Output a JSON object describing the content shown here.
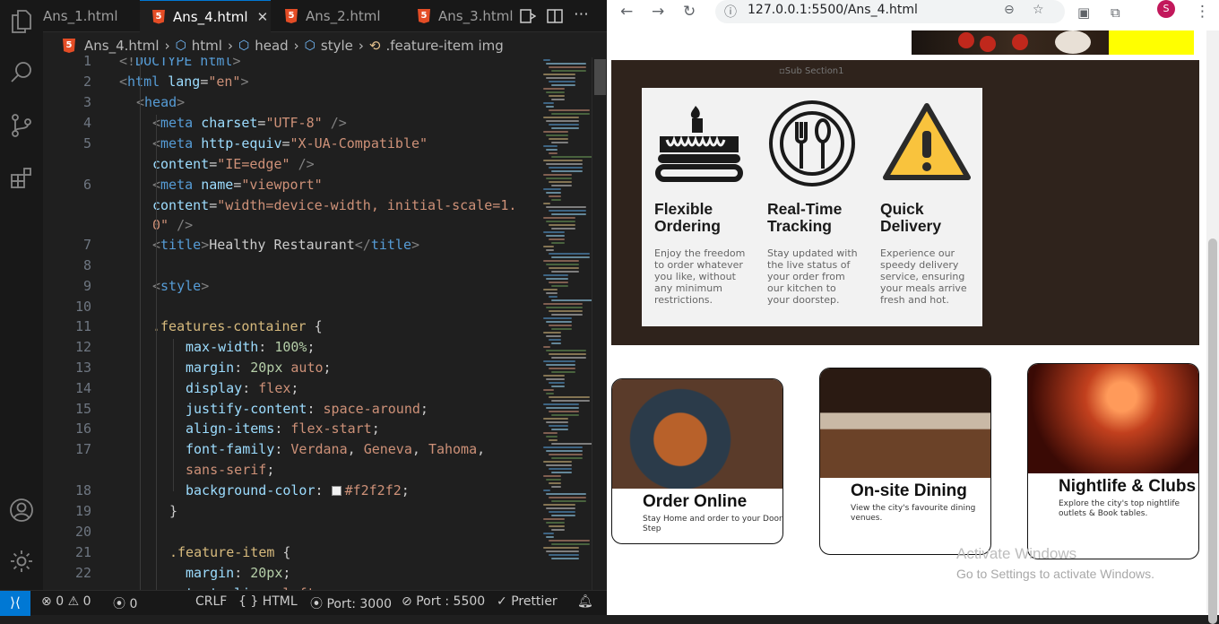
{
  "editor": {
    "tabs": [
      {
        "label": "Ans_1.html",
        "active": false
      },
      {
        "label": "Ans_4.html",
        "active": true
      },
      {
        "label": "Ans_2.html",
        "active": false
      },
      {
        "label": "Ans_3.html",
        "active": false
      }
    ],
    "breadcrumb": [
      "Ans_4.html",
      "html",
      "head",
      "style",
      ".feature-item img"
    ],
    "line_numbers": [
      "1",
      "2",
      "3",
      "4",
      "5",
      "6",
      "7",
      "8",
      "9",
      "10",
      "11",
      "12",
      "13",
      "14",
      "15",
      "16",
      "17",
      "18",
      "19",
      "20",
      "21",
      "22"
    ],
    "status": {
      "errors": "0",
      "warnings": "0",
      "ports_count": "0",
      "eol": "CRLF",
      "language": "HTML",
      "port1": "Port: 3000",
      "port2": "Port : 5500",
      "formatter": "Prettier"
    }
  },
  "browser": {
    "url": "127.0.0.1:5500/Ans_4.html",
    "avatar_letter": "S",
    "broken_image_alt": "Sub Section1",
    "features": [
      {
        "icon": "cake-icon",
        "title": "Flexible Ordering",
        "text": "Enjoy the freedom to order whatever you like, without any minimum restrictions."
      },
      {
        "icon": "fork-spoon-icon",
        "title": "Real-Time Tracking",
        "text": "Stay updated with the live status of your order from our kitchen to your doorstep."
      },
      {
        "icon": "warning-icon",
        "title": "Quick Delivery",
        "text": "Experience our speedy delivery service, ensuring your meals arrive fresh and hot."
      }
    ],
    "cards": [
      {
        "title": "Order Online",
        "text": "Stay Home and order to your Door Step"
      },
      {
        "title": "On-site Dining",
        "text": "View the city's favourite dining venues."
      },
      {
        "title": "Nightlife & Clubs",
        "text": "Explore the city's top nightlife outlets & Book tables."
      }
    ],
    "watermark_title": "Activate Windows",
    "watermark_sub": "Go to Settings to activate Windows."
  },
  "colors": {
    "accent": "#0078d4",
    "section_bg": "#2f231c",
    "feature_bg": "#f2f2f2",
    "highlight": "#ffff00"
  }
}
